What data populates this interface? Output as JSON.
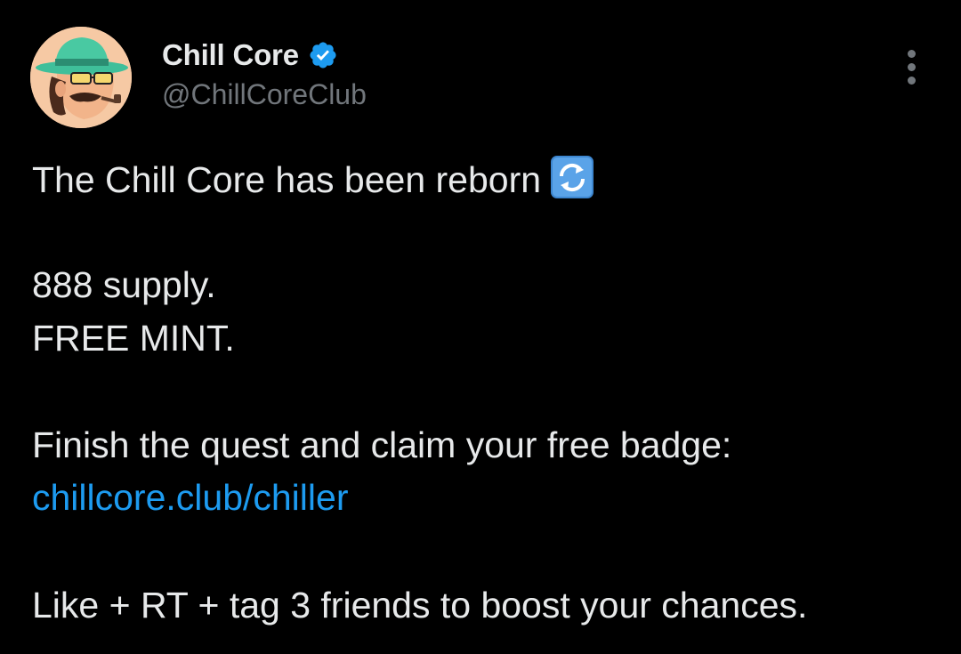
{
  "tweet": {
    "author": {
      "display_name": "Chill Core",
      "handle": "@ChillCoreClub",
      "avatar_icon": "cartoon-man-green-hat-avatar",
      "verified_icon": "verified-badge-icon",
      "verified_color": "#1d9bf0"
    },
    "more_icon": "more-options-icon",
    "body": {
      "line1": "The Chill Core has been reborn",
      "line1_emoji": "repeat-arrows-emoji",
      "line2": "888 supply.",
      "line3": "FREE MINT.",
      "line4": "Finish the quest and claim your free badge:",
      "link_text": "chillcore.club/chiller",
      "line6": "Like + RT + tag 3 friends to boost your chances."
    }
  },
  "colors": {
    "background": "#000000",
    "text": "#e7e9ea",
    "secondary_text": "#71767b",
    "link": "#1d9bf0"
  }
}
